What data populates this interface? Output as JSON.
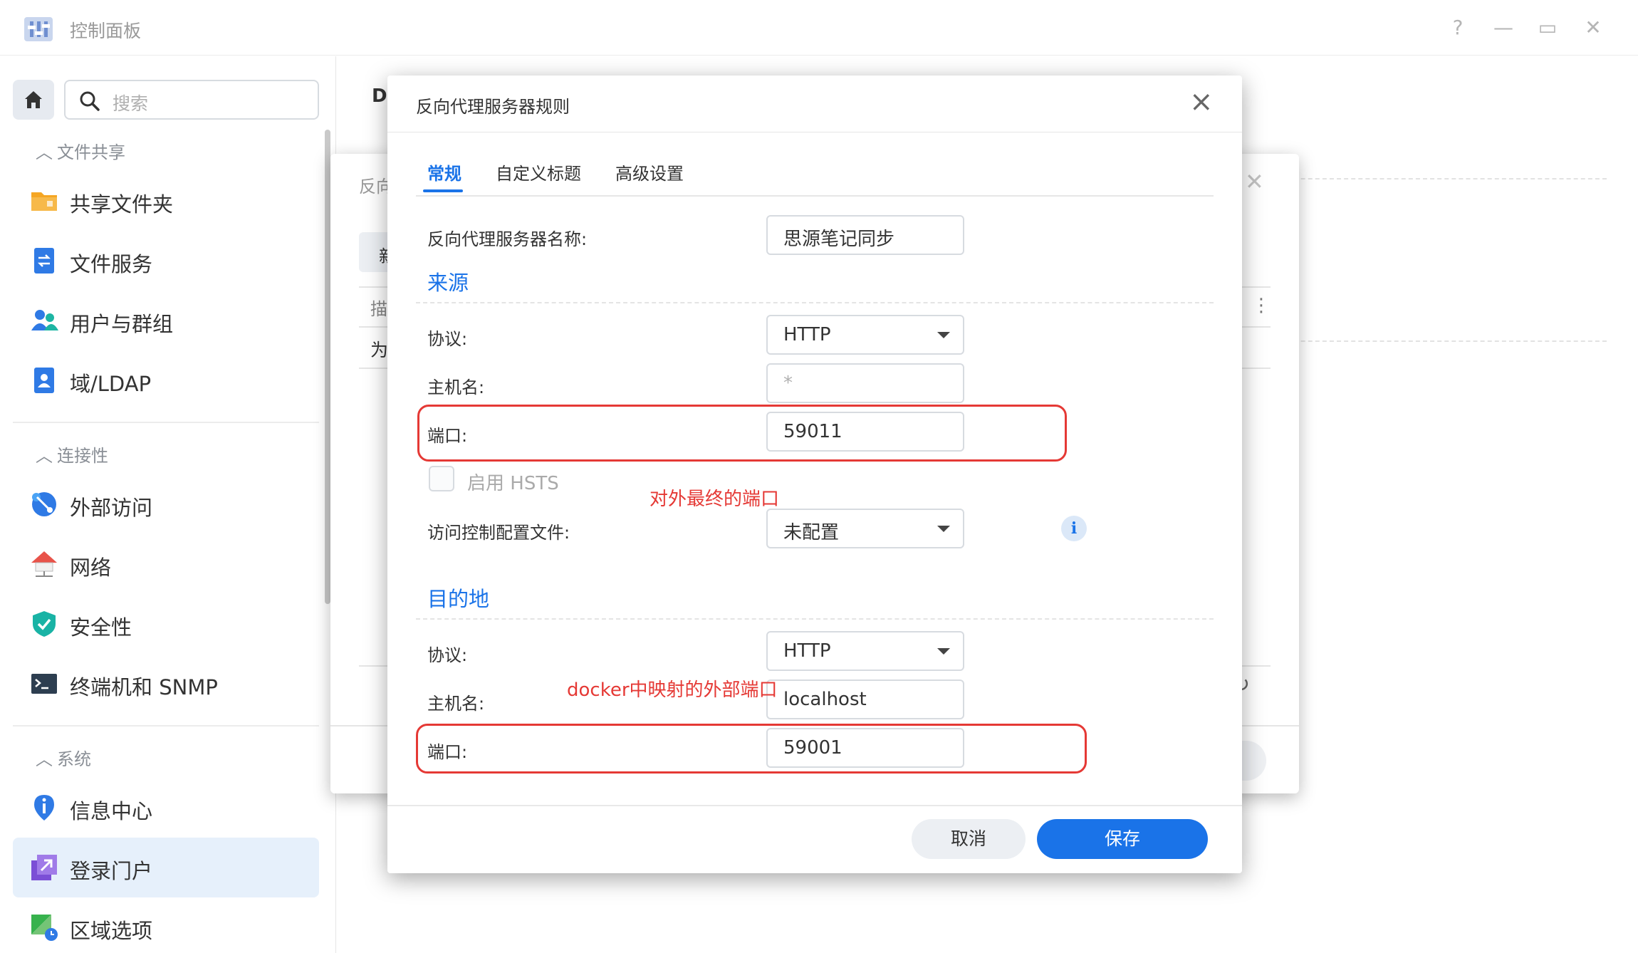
{
  "window": {
    "title": "控制面板",
    "help": "?",
    "minimize": "—",
    "maximize": "▭",
    "close": "✕"
  },
  "sidebar": {
    "search_placeholder": "搜索",
    "sections": [
      {
        "label": "文件共享",
        "items": [
          {
            "label": "共享文件夹",
            "icon": "folder-icon"
          },
          {
            "label": "文件服务",
            "icon": "file-services-icon"
          },
          {
            "label": "用户与群组",
            "icon": "users-icon"
          },
          {
            "label": "域/LDAP",
            "icon": "ldap-icon"
          }
        ]
      },
      {
        "label": "连接性",
        "items": [
          {
            "label": "外部访问",
            "icon": "external-access-icon"
          },
          {
            "label": "网络",
            "icon": "network-icon"
          },
          {
            "label": "安全性",
            "icon": "shield-icon"
          },
          {
            "label": "终端机和 SNMP",
            "icon": "terminal-icon"
          }
        ]
      },
      {
        "label": "系统",
        "items": [
          {
            "label": "信息中心",
            "icon": "info-center-icon"
          },
          {
            "label": "登录门户",
            "icon": "login-portal-icon",
            "active": true
          },
          {
            "label": "区域选项",
            "icon": "regional-options-icon"
          }
        ]
      }
    ]
  },
  "background": {
    "page_letter": "D",
    "dialog_title": "反向",
    "new_button": "新",
    "column_head": "描",
    "row_cell": "为"
  },
  "dialog": {
    "title": "反向代理服务器规则",
    "tabs": [
      "常规",
      "自定义标题",
      "高级设置"
    ],
    "name_label": "反向代理服务器名称:",
    "name_value": "思源笔记同步",
    "source": {
      "title": "来源",
      "protocol_label": "协议:",
      "protocol_value": "HTTP",
      "hostname_label": "主机名:",
      "hostname_placeholder": "*",
      "port_label": "端口:",
      "port_value": "59011",
      "hsts_label": "启用 HSTS",
      "acl_label": "访问控制配置文件:",
      "acl_value": "未配置"
    },
    "destination": {
      "title": "目的地",
      "protocol_label": "协议:",
      "protocol_value": "HTTP",
      "hostname_label": "主机名:",
      "hostname_value": "localhost",
      "port_label": "端口:",
      "port_value": "59001"
    },
    "cancel": "取消",
    "save": "保存"
  },
  "annotations": {
    "source_port_note": "对外最终的端口",
    "dest_port_note": "docker中映射的外部端口"
  },
  "colors": {
    "accent": "#1a73e8",
    "annotation": "#e53935"
  }
}
